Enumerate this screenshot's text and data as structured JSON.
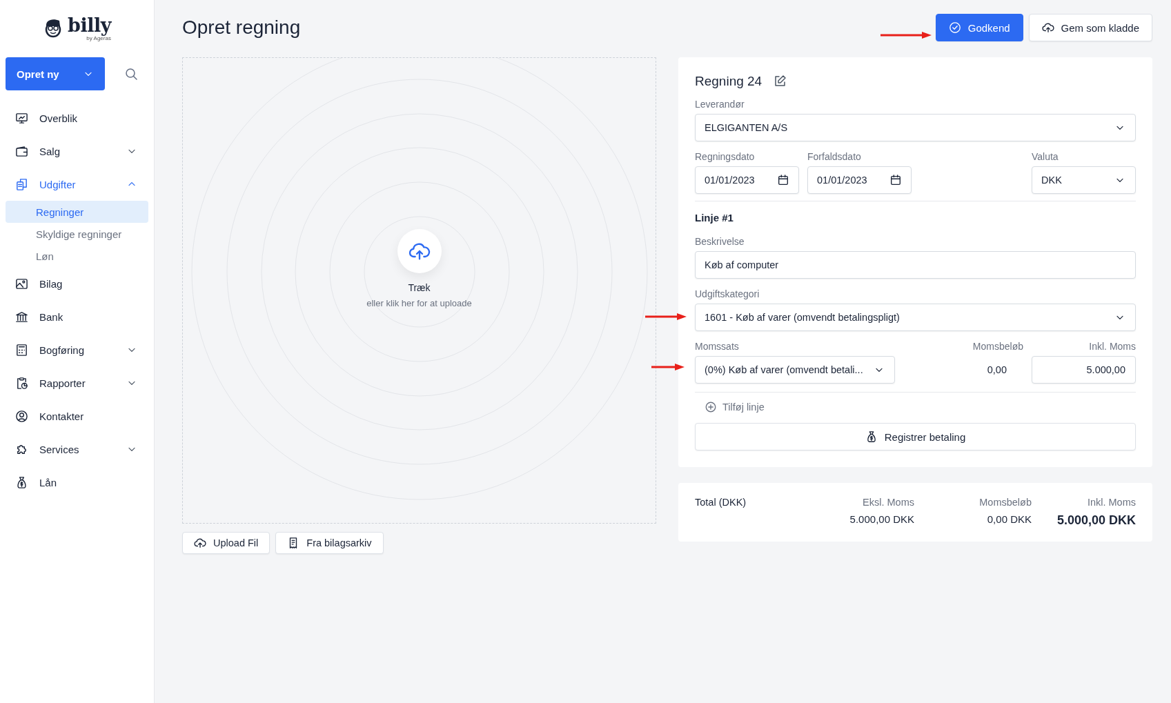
{
  "sidebar": {
    "logo": {
      "name": "billy",
      "tagline": "by Ageras"
    },
    "create_button": "Opret ny",
    "items": [
      {
        "label": "Overblik",
        "selected": false
      },
      {
        "label": "Salg",
        "selected": false,
        "expanded": false
      },
      {
        "label": "Udgifter",
        "selected": true,
        "expanded": true,
        "children": [
          {
            "label": "Regninger",
            "selected": true
          },
          {
            "label": "Skyldige regninger",
            "selected": false
          },
          {
            "label": "Løn",
            "selected": false
          }
        ]
      },
      {
        "label": "Bilag",
        "selected": false
      },
      {
        "label": "Bank",
        "selected": false
      },
      {
        "label": "Bogføring",
        "selected": false,
        "expanded": false
      },
      {
        "label": "Rapporter",
        "selected": false,
        "expanded": false
      },
      {
        "label": "Kontakter",
        "selected": false
      },
      {
        "label": "Services",
        "selected": false,
        "expanded": false
      },
      {
        "label": "Lån",
        "selected": false
      }
    ]
  },
  "header": {
    "title": "Opret regning",
    "buttons": [
      {
        "label": "Godkend",
        "kind": "primary"
      },
      {
        "label": "Gem som kladde",
        "kind": "secondary"
      }
    ]
  },
  "upload": {
    "title": "Træk",
    "subtitle": "eller klik her for at uploade",
    "buttons": [
      "Upload Fil",
      "Fra bilagsarkiv"
    ]
  },
  "bill": {
    "title": "Regning 24",
    "supplier": {
      "label": "Leverandør",
      "value": "ELGIGANTEN A/S"
    },
    "bill_date": {
      "label": "Regningsdato",
      "value": "01/01/2023"
    },
    "due_date": {
      "label": "Forfaldsdato",
      "value": "01/01/2023"
    },
    "currency": {
      "label": "Valuta",
      "value": "DKK"
    },
    "lines": [
      {
        "title": "Linje #1",
        "description": {
          "label": "Beskrivelse",
          "value": "Køb af computer"
        },
        "category": {
          "label": "Udgiftskategori",
          "value": "1601 -  Køb af varer (omvendt betalingspligt)"
        },
        "vat_rate": {
          "label": "Momssats",
          "value": "(0%) Køb af varer (omvendt betali..."
        },
        "vat_amount": {
          "label": "Momsbeløb",
          "value": "0,00"
        },
        "incl_vat": {
          "label": "Inkl. Moms",
          "value": "5.000,00"
        }
      }
    ],
    "add_line": "Tilføj linje",
    "register_payment": "Registrer betaling"
  },
  "totals": {
    "label": "Total (DKK)",
    "columns": [
      {
        "label": "Eksl. Moms",
        "value": "5.000,00 DKK"
      },
      {
        "label": "Momsbeløb",
        "value": "0,00 DKK"
      },
      {
        "label": "Inkl. Moms",
        "value": "5.000,00 DKK"
      }
    ]
  }
}
